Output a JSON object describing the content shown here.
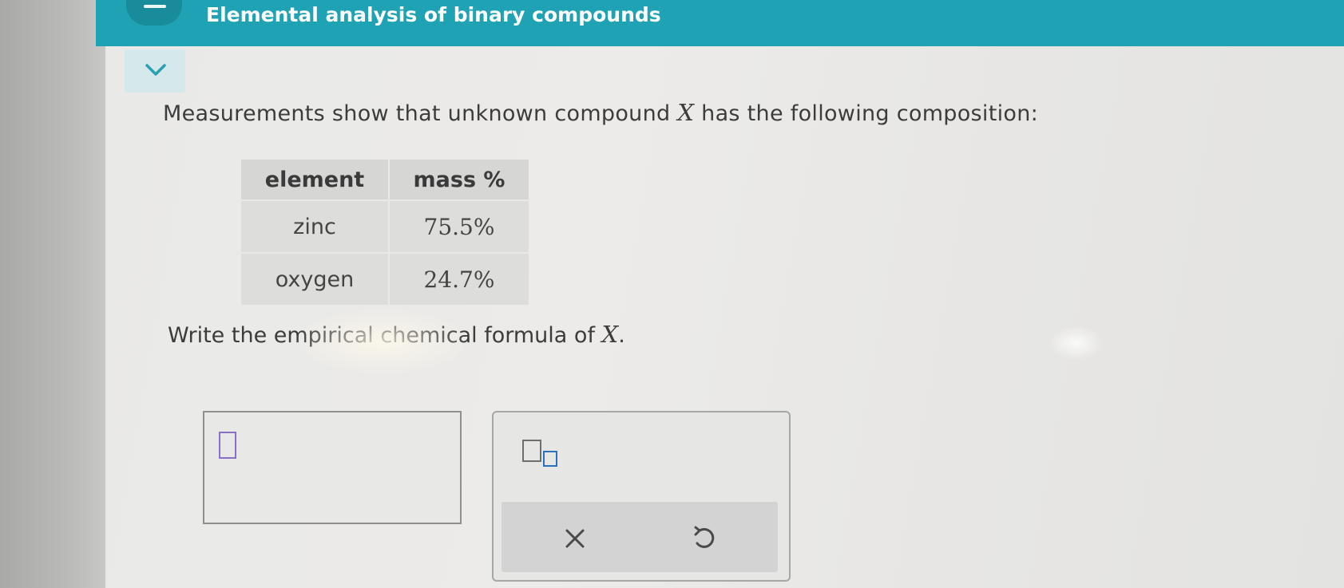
{
  "header": {
    "title": "Elemental analysis of binary compounds"
  },
  "prompt": {
    "text_before": "Measurements show that unknown compound ",
    "variable": "X",
    "text_after": " has the following composition:"
  },
  "table": {
    "headers": [
      "element",
      "mass %"
    ],
    "rows": [
      {
        "element": "zinc",
        "mass": "75.5%"
      },
      {
        "element": "oxygen",
        "mass": "24.7%"
      }
    ]
  },
  "question": {
    "text_before": "Write the empirical chemical formula of ",
    "variable": "X",
    "text_after": "."
  },
  "palette": {
    "clear_symbol": "×",
    "undo_icon": "undo-icon"
  },
  "colors": {
    "header": "#1fa3b4",
    "cursor_box": "#8a6fc7",
    "subscript_box": "#2b6fbf"
  }
}
